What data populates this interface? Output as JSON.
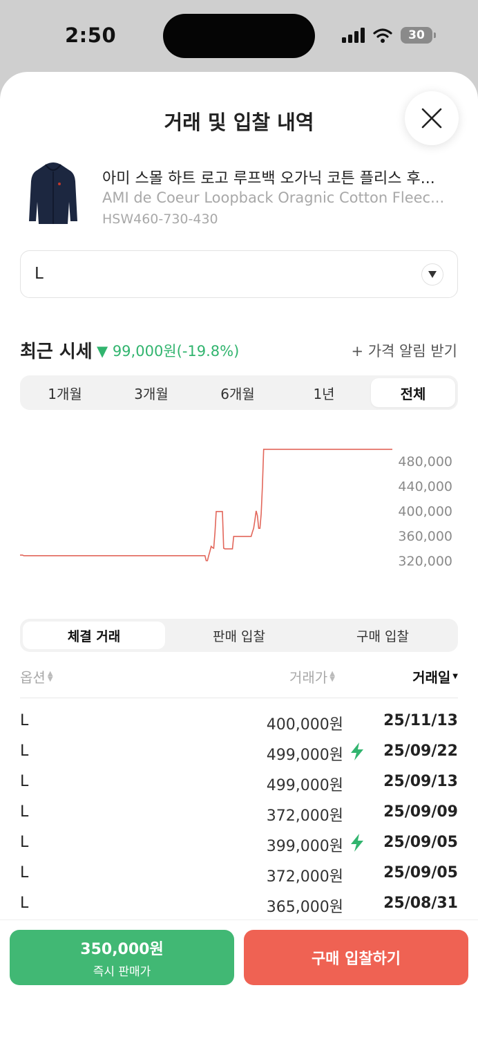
{
  "status_bar": {
    "time": "2:50",
    "battery": "30"
  },
  "sheet": {
    "title": "거래 및 입찰 내역"
  },
  "product": {
    "name_ko": "아미 스몰 하트 로고 루프백 오가닉 코튼 플리스 후...",
    "name_en": "AMI de Coeur Loopback Oragnic Cotton Fleec...",
    "code": "HSW460-730-430"
  },
  "size_select": {
    "value": "L"
  },
  "recent": {
    "label": "최근 시세",
    "change": "▼ 99,000원(-19.8%)",
    "change_color": "#31b46e",
    "alert": "+ 가격 알림 받기"
  },
  "period_tabs": [
    {
      "label": "1개월"
    },
    {
      "label": "3개월"
    },
    {
      "label": "6개월"
    },
    {
      "label": "1년"
    },
    {
      "label": "전체",
      "active": true
    }
  ],
  "chart_data": {
    "type": "line",
    "line_color": "#e2665a",
    "y_ticks": [
      "480,000",
      "440,000",
      "400,000",
      "360,000",
      "320,000"
    ],
    "ylim": [
      300000,
      500000
    ],
    "values": [
      329000,
      329000,
      329000,
      328000,
      328000,
      328000,
      328000,
      328000,
      328000,
      328000,
      328000,
      328000,
      328000,
      328000,
      328000,
      328000,
      328000,
      328000,
      328000,
      328000,
      328000,
      328000,
      328000,
      328000,
      328000,
      328000,
      328000,
      328000,
      328000,
      328000,
      328000,
      328000,
      328000,
      328000,
      328000,
      328000,
      328000,
      328000,
      328000,
      328000,
      328000,
      328000,
      328000,
      328000,
      328000,
      328000,
      328000,
      328000,
      328000,
      328000,
      328000,
      328000,
      328000,
      328000,
      328000,
      328000,
      328000,
      328000,
      328000,
      328000,
      328000,
      328000,
      328000,
      328000,
      328000,
      328000,
      328000,
      328000,
      328000,
      328000,
      328000,
      328000,
      328000,
      328000,
      328000,
      328000,
      328000,
      328000,
      328000,
      328000,
      328000,
      328000,
      328000,
      328000,
      328000,
      328000,
      328000,
      328000,
      328000,
      328000,
      328000,
      328000,
      328000,
      328000,
      328000,
      328000,
      328000,
      328000,
      328000,
      328000,
      328000,
      328000,
      328000,
      328000,
      328000,
      328000,
      328000,
      328000,
      328000,
      328000,
      328000,
      328000,
      328000,
      328000,
      328000,
      328000,
      328000,
      328000,
      328000,
      328000,
      328000,
      328000,
      328000,
      328000,
      328000,
      328000,
      328000,
      328000,
      328000,
      328000,
      328000,
      328000,
      328000,
      328000,
      328000,
      328000,
      328000,
      328000,
      328000,
      328000,
      328000,
      328000,
      328000,
      328000,
      328000,
      328000,
      328000,
      328000,
      328000,
      320000,
      320000,
      328000,
      335000,
      343000,
      341000,
      340000,
      365000,
      399000,
      399000,
      399000,
      399000,
      399000,
      399000,
      340000,
      339000,
      339000,
      339000,
      339000,
      339000,
      339000,
      339000,
      359000,
      359000,
      359000,
      359000,
      359000,
      359000,
      359000,
      359000,
      359000,
      359000,
      359000,
      359000,
      359000,
      359000,
      359000,
      366000,
      372000,
      385000,
      400000,
      392000,
      372000,
      372000,
      395000,
      440000,
      499000,
      499000,
      499000,
      499000,
      499000,
      499000,
      499000,
      499000,
      499000,
      499000,
      499000,
      499000,
      499000,
      499000,
      499000,
      499000,
      499000,
      499000,
      499000,
      499000,
      499000,
      499000,
      499000,
      499000,
      499000,
      499000,
      499000,
      499000,
      499000,
      499000,
      499000,
      499000,
      499000,
      499000,
      499000,
      499000,
      499000,
      499000,
      499000,
      499000,
      499000,
      499000,
      499000,
      499000,
      499000,
      499000,
      499000,
      499000,
      499000,
      499000,
      499000,
      499000,
      499000,
      499000,
      499000,
      499000,
      499000,
      499000,
      499000,
      499000,
      499000,
      499000,
      499000,
      499000,
      499000,
      499000,
      499000,
      499000,
      499000,
      499000,
      499000,
      499000,
      499000,
      499000,
      499000,
      499000,
      499000,
      499000,
      499000,
      499000,
      499000,
      499000,
      499000,
      499000,
      499000,
      499000,
      499000,
      499000,
      499000,
      499000,
      499000,
      499000,
      499000,
      499000,
      499000,
      499000,
      499000,
      499000,
      499000,
      499000,
      499000,
      499000,
      499000,
      499000
    ]
  },
  "trade_tabs": [
    {
      "label": "체결 거래",
      "active": true
    },
    {
      "label": "판매 입찰"
    },
    {
      "label": "구매 입찰"
    }
  ],
  "table": {
    "columns": {
      "option": "옵션",
      "price": "거래가",
      "date": "거래일"
    },
    "rows": [
      {
        "option": "L",
        "price": "400,000원",
        "date": "25/11/13",
        "quick": false
      },
      {
        "option": "L",
        "price": "499,000원",
        "date": "25/09/22",
        "quick": true
      },
      {
        "option": "L",
        "price": "499,000원",
        "date": "25/09/13",
        "quick": false
      },
      {
        "option": "L",
        "price": "372,000원",
        "date": "25/09/09",
        "quick": false
      },
      {
        "option": "L",
        "price": "399,000원",
        "date": "25/09/05",
        "quick": true
      },
      {
        "option": "L",
        "price": "372,000원",
        "date": "25/09/05",
        "quick": false
      },
      {
        "option": "L",
        "price": "365,000원",
        "date": "25/08/31",
        "quick": false
      }
    ]
  },
  "bottom": {
    "sell_price": "350,000원",
    "sell_label": "즉시 판매가",
    "sell_color": "#41b874",
    "buy_label": "구매 입찰하기",
    "buy_color": "#ef6253"
  }
}
